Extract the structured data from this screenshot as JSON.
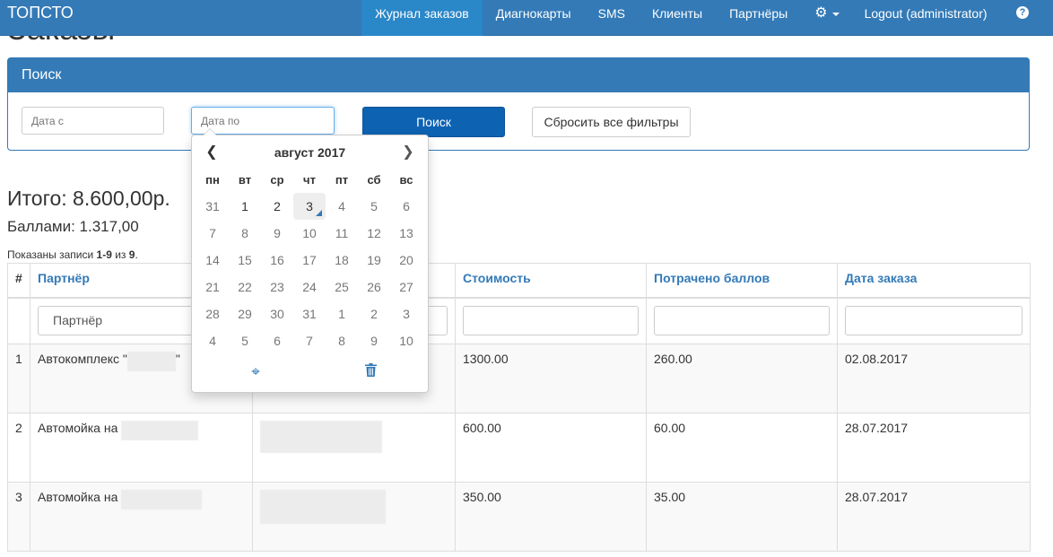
{
  "navbar": {
    "brand": "ТОПСТО",
    "items": [
      {
        "label": "Журнал заказов",
        "active": true
      },
      {
        "label": "Диагнокарты"
      },
      {
        "label": "SMS"
      },
      {
        "label": "Клиенты"
      },
      {
        "label": "Партнёры"
      }
    ],
    "settings_icon": "gear-icon",
    "logout": "Logout (administrator)",
    "help": "?"
  },
  "page": {
    "heading": "Заказы"
  },
  "search": {
    "title": "Поиск",
    "date_from_placeholder": "Дата с",
    "date_to_placeholder": "Дата по",
    "search_label": "Поиск",
    "reset_label": "Сбросить все фильтры"
  },
  "totals": {
    "total": "Итого: 8.600,00р.",
    "points": "Баллами: 1.317,00",
    "summary_prefix": "Показаны записи ",
    "summary_range": "1-9",
    "summary_mid": " из ",
    "summary_count": "9",
    "summary_suffix": "."
  },
  "table": {
    "headers": {
      "num": "#",
      "partner": "Партнёр",
      "client": "",
      "cost": "Стоимость",
      "points_spent": "Потрачено баллов",
      "order_date": "Дата заказа"
    },
    "filters": {
      "partner_value": "Партнёр"
    },
    "rows": [
      {
        "num": "1",
        "partner": "Автокомплекс \"",
        "partner_end": "\"",
        "cost": "1300.00",
        "points": "260.00",
        "date": "02.08.2017"
      },
      {
        "num": "2",
        "partner": "Автомойка на",
        "cost": "600.00",
        "points": "60.00",
        "date": "28.07.2017"
      },
      {
        "num": "3",
        "partner": "Автомойка на",
        "cost": "350.00",
        "points": "35.00",
        "date": "28.07.2017"
      }
    ]
  },
  "datepicker": {
    "month_title": "август 2017",
    "weekdays": [
      "пн",
      "вт",
      "ср",
      "чт",
      "пт",
      "сб",
      "вс"
    ],
    "weeks": [
      [
        "31",
        "1",
        "2",
        "3",
        "4",
        "5",
        "6"
      ],
      [
        "7",
        "8",
        "9",
        "10",
        "11",
        "12",
        "13"
      ],
      [
        "14",
        "15",
        "16",
        "17",
        "18",
        "19",
        "20"
      ],
      [
        "21",
        "22",
        "23",
        "24",
        "25",
        "26",
        "27"
      ],
      [
        "28",
        "29",
        "30",
        "31",
        "1",
        "2",
        "3"
      ],
      [
        "4",
        "5",
        "6",
        "7",
        "8",
        "9",
        "10"
      ]
    ],
    "today": "3",
    "tools": [
      "crosshairs-icon",
      "trash-icon"
    ]
  }
}
